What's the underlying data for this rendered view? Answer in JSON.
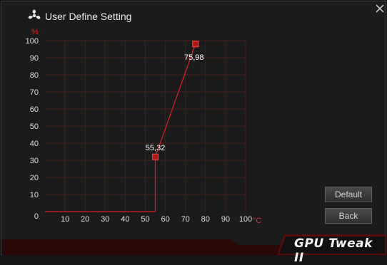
{
  "window": {
    "title": "User Define Setting"
  },
  "buttons": {
    "default_label": "Default",
    "back_label": "Back"
  },
  "logo": {
    "text": "GPU Tweak II"
  },
  "colors": {
    "accent": "#d42020",
    "grid": "#4a1c1c",
    "background": "#1b1b1b"
  },
  "icons": {
    "title": "fan-icon",
    "close": "close-icon"
  },
  "chart_data": {
    "type": "line",
    "x_unit": "°C",
    "y_unit": "%",
    "xlim": [
      0,
      100
    ],
    "ylim": [
      0,
      100
    ],
    "x_ticks": [
      "0",
      "10",
      "20",
      "30",
      "40",
      "50",
      "60",
      "70",
      "80",
      "90",
      "100"
    ],
    "y_ticks": [
      "0",
      "10",
      "20",
      "30",
      "40",
      "50",
      "60",
      "70",
      "80",
      "90",
      "100"
    ],
    "grid": true,
    "series": [
      {
        "points": [
          [
            0,
            0
          ],
          [
            55,
            0
          ],
          [
            55,
            32
          ],
          [
            75,
            98
          ]
        ],
        "control_points": [
          [
            55,
            32
          ],
          [
            75,
            98
          ]
        ],
        "point_labels": [
          "55,32",
          "75,98"
        ]
      }
    ]
  }
}
